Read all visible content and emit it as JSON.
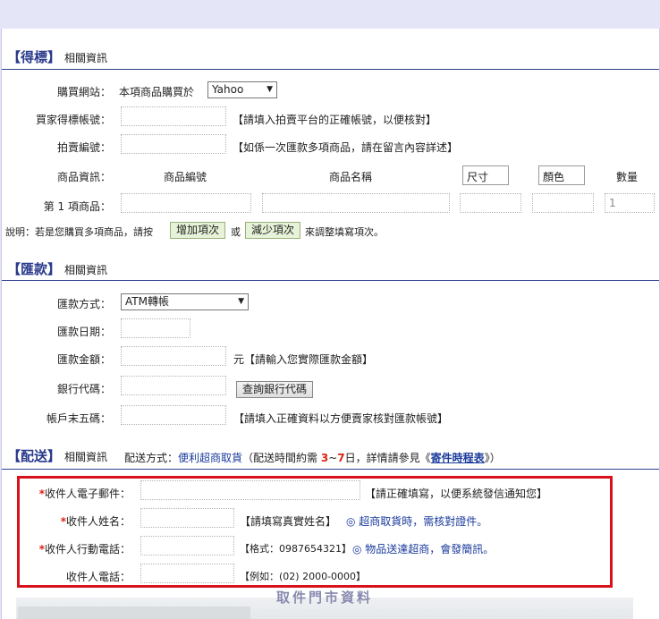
{
  "sections": {
    "bid": {
      "title": "【得標】",
      "subtitle": "相關資訊",
      "site_label": "購買網站：",
      "site_text": "本項商品購買於",
      "site_value": "Yahoo",
      "buyer_label": "買家得標帳號：",
      "buyer_hint": "【請填入拍賣平台的正確帳號，以便核對】",
      "auction_label": "拍賣編號：",
      "auction_hint": "【如係一次匯款多項商品，請在留言內容詳述】",
      "product_label": "商品資訊：",
      "col_code": "商品編號",
      "col_name": "商品名稱",
      "col_size": "尺寸",
      "col_color": "顏色",
      "col_qty": "數量",
      "item1_label": "第 1 項商品：",
      "item1_qty": "1",
      "note_prefix": "說明：若是您購買多項商品，請按",
      "add_button": "增加項次",
      "or_text": "或",
      "remove_button": "減少項次",
      "note_suffix": "來調整填寫項次。"
    },
    "remit": {
      "title": "【匯款】",
      "subtitle": "相關資訊",
      "method_label": "匯款方式：",
      "method_value": "ATM轉帳",
      "date_label": "匯款日期：",
      "amount_label": "匯款金額：",
      "amount_hint": "元【請輸入您實際匯款金額】",
      "bank_label": "銀行代碼：",
      "bank_button": "查詢銀行代碼",
      "last5_label": "帳戶末五碼：",
      "last5_hint": "【請填入正確資料以方便賣家核對匯款帳號】"
    },
    "ship": {
      "title": "【配送】",
      "subtitle": "相關資訊",
      "method_prefix": "配送方式：",
      "method_value": "便利超商取貨",
      "time_prefix": "（配送時間約需",
      "days_from": "3",
      "tilde": "~",
      "days_to": "7",
      "time_suffix": "日，詳情請參見《",
      "schedule_link": "寄件時程表",
      "close_paren": "》）",
      "email_label": "收件人電子郵件：",
      "email_hint": "【請正確填寫，以便系統發信通知您】",
      "name_label": "收件人姓名：",
      "name_hint": "【請填寫真實姓名】",
      "name_note": "◎ 超商取貨時，需核對證件。",
      "mobile_label": "收件人行動電話：",
      "mobile_hint": "【格式：0987654321】",
      "mobile_note": "◎ 物品送達超商，會發簡訊。",
      "phone_label": "收件人電話：",
      "phone_hint": "【例如：(02) 2000-0000】",
      "required_mark": "*",
      "pickup_title": "取件門市資料"
    }
  },
  "colors": {
    "accent": "#2a3a8c",
    "required": "#d21111",
    "highlight_box": "#d9111a",
    "page_bg": "#e4e5f7"
  }
}
